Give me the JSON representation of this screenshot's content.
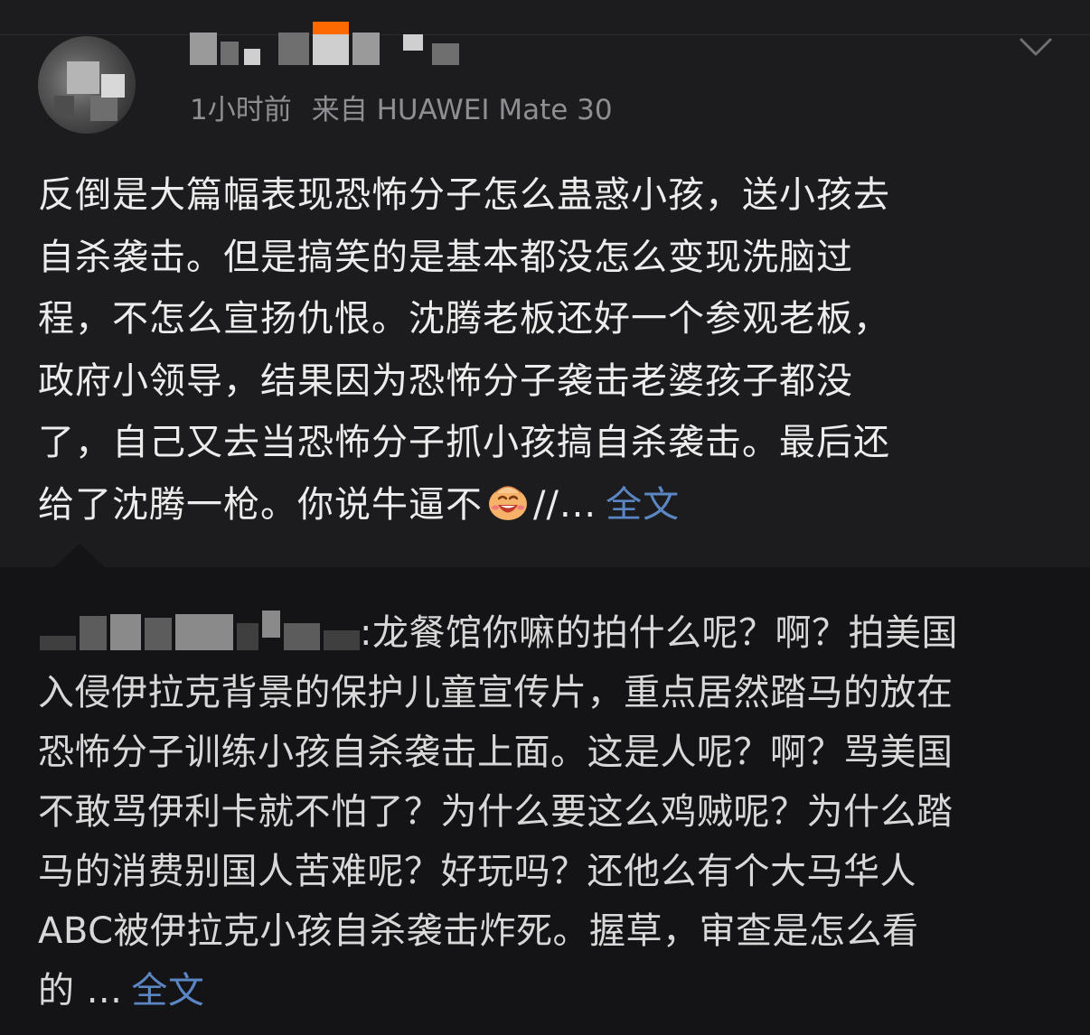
{
  "post": {
    "username_obscured": true,
    "timestamp": "1小时前",
    "source": "来自 HUAWEI Mate 30",
    "body_lines": [
      "反倒是大篇幅表现恐怖分子怎么蛊惑小孩，送小孩去",
      "自杀袭击。但是搞笑的是基本都没怎么变现洗脑过",
      "程，不怎么宣扬仇恨。沈腾老板还好一个参观老板，",
      "政府小领导，结果因为恐怖分子袭击老婆孩子都没",
      "了，自己又去当恐怖分子抓小孩搞自杀袭击。最后还"
    ],
    "body_last_prefix": "给了沈腾一枪。你说牛逼不",
    "body_last_suffix": "//...",
    "more_label": "全文",
    "emoji_name": "laughing-face-emoji",
    "accent_color": "#5b86c4"
  },
  "quote": {
    "author_obscured": true,
    "first_line": ":龙餐馆你嘛的拍什么呢？啊？拍美国",
    "lines": [
      "入侵伊拉克背景的保护儿童宣传片，重点居然踏马的放在",
      "恐怖分子训练小孩自杀袭击上面。这是人呢？啊？骂美国",
      "不敢骂伊利卡就不怕了？为什么要这么鸡贼呢？为什么踏",
      "马的消费别国人苦难呢？好玩吗？还他么有个大马华人",
      "ABC被伊拉克小孩自杀袭击炸死。握草，审查是怎么看"
    ],
    "last_prefix": "的 ...",
    "more_label": "全文"
  }
}
